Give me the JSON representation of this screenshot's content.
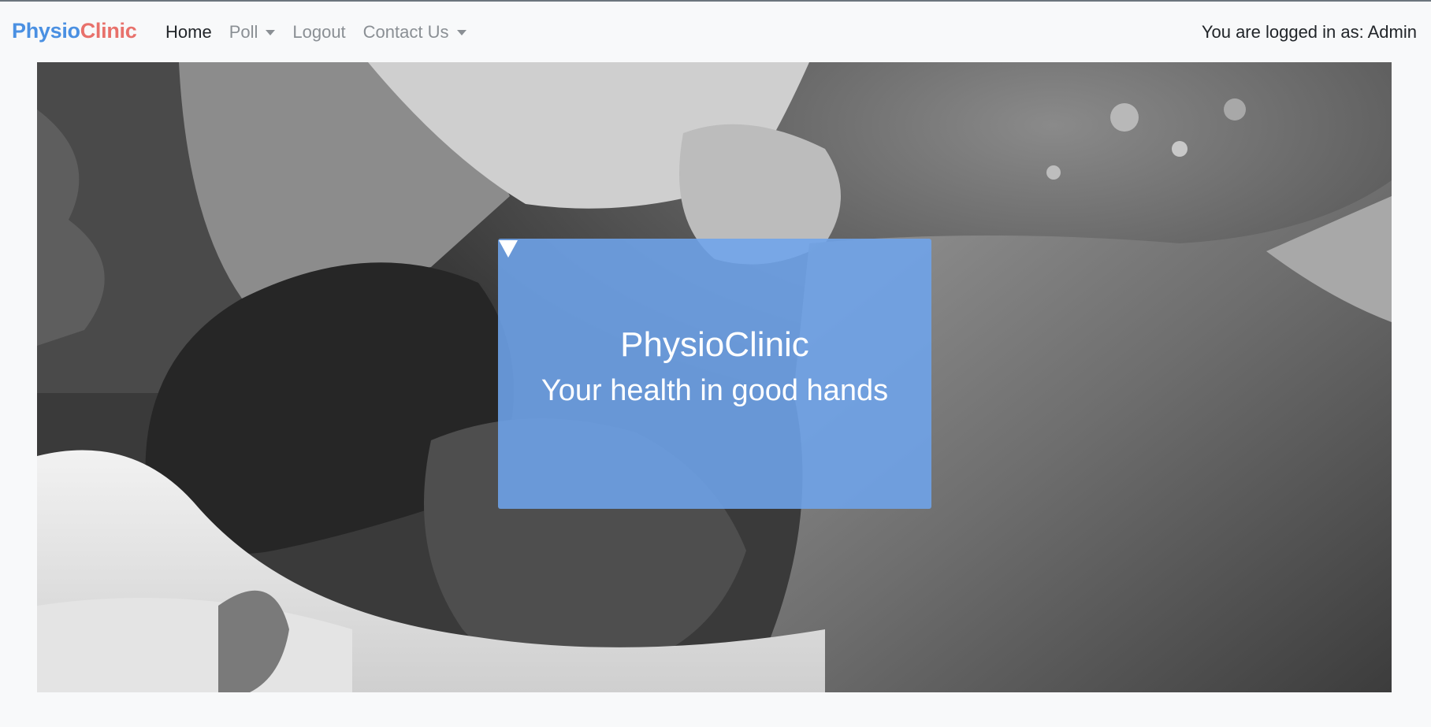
{
  "brand": {
    "part1": "Physio",
    "part2": "Clinic"
  },
  "nav": {
    "items": [
      {
        "label": "Home"
      },
      {
        "label": "Poll"
      },
      {
        "label": "Logout"
      },
      {
        "label": "Contact Us"
      }
    ]
  },
  "user_status": "You are logged in as: Admin",
  "hero": {
    "title": "PhysioClinic",
    "tagline": "Your health in good hands",
    "scroll_icon": "triangle-down-icon"
  },
  "colors": {
    "brand_blue": "#4a90e2",
    "brand_red": "#e8716b",
    "overlay": "#6ea4ec",
    "navbar_bg": "#f8f9fa"
  }
}
